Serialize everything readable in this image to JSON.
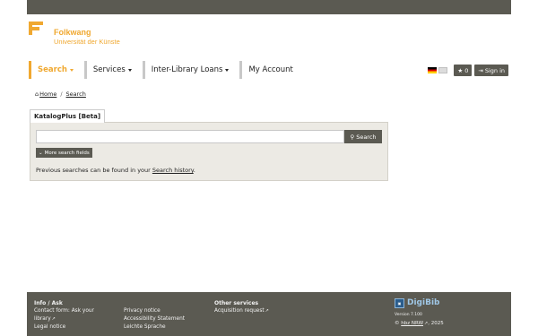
{
  "logo": {
    "line1": "Folkwang",
    "line2": "Universität der Künste"
  },
  "nav": {
    "items": [
      {
        "label": "Search",
        "caret": true,
        "active": true
      },
      {
        "label": "Services",
        "caret": true,
        "active": false
      },
      {
        "label": "Inter-Library Loans",
        "caret": true,
        "active": false
      },
      {
        "label": "My Account",
        "caret": false,
        "active": false
      }
    ],
    "favorites_count": "0",
    "signin_label": "Sign in"
  },
  "breadcrumb": {
    "home": "Home",
    "current": "Search"
  },
  "search": {
    "tab_label": "KatalogPlus [Beta]",
    "input_value": "",
    "button_label": "Search",
    "more_fields_label": "More search fields",
    "previous_text": "Previous searches can be found in your ",
    "history_link": "Search history",
    "previous_suffix": "."
  },
  "footer": {
    "info_heading": "Info / Ask",
    "contact_link": "Contact form: Ask your library",
    "legal_link": "Legal notice",
    "privacy_link": "Privacy notice",
    "accessibility_link": "Accessibility Statement",
    "easy_language_link": "Leichte Sprache",
    "other_heading": "Other services",
    "acquisition_link": "Acquisition request",
    "digibib_name": "DigiBib",
    "version": "Version 7.100",
    "copyright_prefix": "© ",
    "hbz_link": "hbz NRW",
    "copyright_suffix": ", 2025"
  },
  "colors": {
    "accent": "#f0a830",
    "dark": "#5b5a52",
    "panel": "#eceae4"
  },
  "icons": [
    "home-icon",
    "search-icon",
    "star-icon",
    "signin-icon",
    "chevron-down-icon",
    "external-link-icon"
  ]
}
